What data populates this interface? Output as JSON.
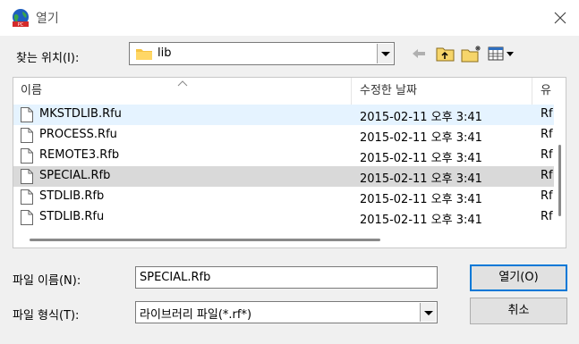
{
  "window": {
    "title": "열기",
    "app_icon": "globe-app-icon",
    "close_icon": "close-icon"
  },
  "lookin": {
    "label": "찾는 위치(I):",
    "value": "lib",
    "folder_icon": "folder-icon"
  },
  "toolbar": {
    "icons": [
      "back-arrow-icon",
      "up-folder-icon",
      "new-folder-icon",
      "view-menu-icon"
    ]
  },
  "list": {
    "columns": [
      "이름",
      "수정한 날짜",
      "유"
    ],
    "rows": [
      {
        "name": "MKSTDLIB.Rfu",
        "date": "2015-02-11 오후 3:41",
        "type": "Rfu",
        "state": "hover"
      },
      {
        "name": "PROCESS.Rfu",
        "date": "2015-02-11 오후 3:41",
        "type": "Rfu",
        "state": ""
      },
      {
        "name": "REMOTE3.Rfb",
        "date": "2015-02-11 오후 3:41",
        "type": "Rfb",
        "state": ""
      },
      {
        "name": "SPECIAL.Rfb",
        "date": "2015-02-11 오후 3:41",
        "type": "Rfb",
        "state": "selected"
      },
      {
        "name": "STDLIB.Rfb",
        "date": "2015-02-11 오후 3:41",
        "type": "Rfb",
        "state": ""
      },
      {
        "name": "STDLIB.Rfu",
        "date": "2015-02-11 오후 3:41",
        "type": "Rfu",
        "state": ""
      }
    ]
  },
  "filename": {
    "label": "파일 이름(N):",
    "value": "SPECIAL.Rfb"
  },
  "filetype": {
    "label": "파일 형식(T):",
    "value": "라이브러리 파일(*.rf*)"
  },
  "buttons": {
    "open": "열기(O)",
    "cancel": "취소"
  },
  "colors": {
    "accent": "#0078d7",
    "hover_row": "#e5f3ff",
    "selected_row": "#d9d9d9"
  }
}
